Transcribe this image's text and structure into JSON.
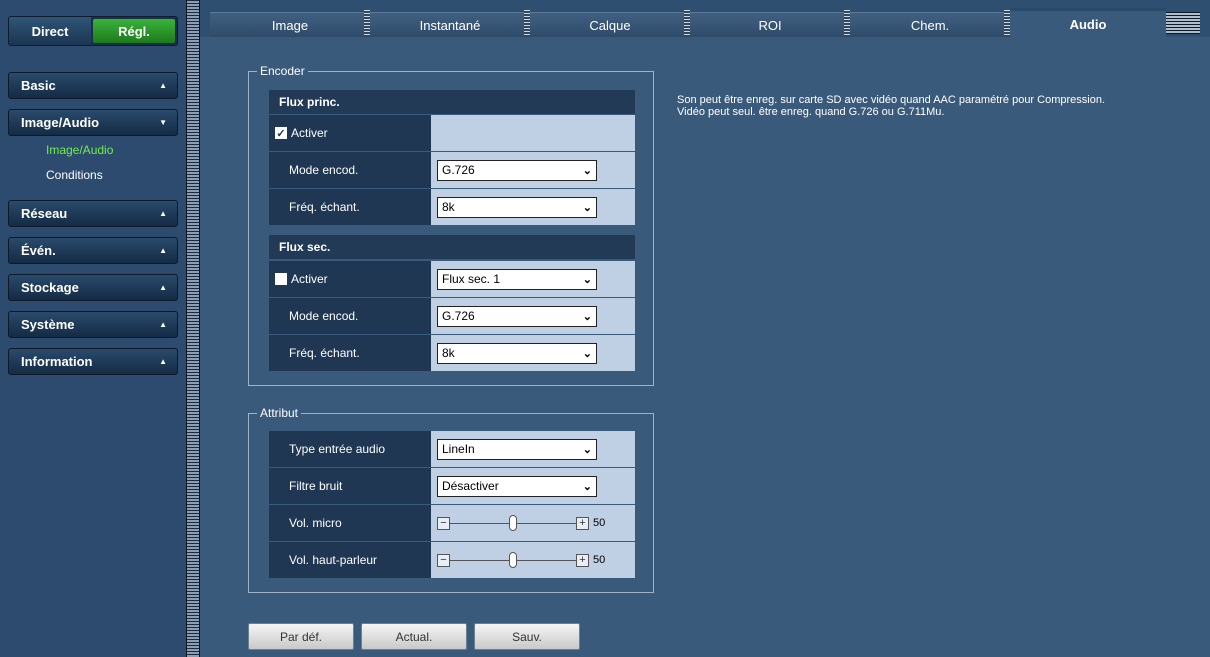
{
  "mode": {
    "direct": "Direct",
    "regl": "Régl."
  },
  "sidebar": {
    "items": [
      {
        "label": "Basic",
        "arrow": "▲"
      },
      {
        "label": "Image/Audio",
        "arrow": "▼",
        "sub": [
          "Image/Audio",
          "Conditions"
        ]
      },
      {
        "label": "Réseau",
        "arrow": "▲"
      },
      {
        "label": "Évén.",
        "arrow": "▲"
      },
      {
        "label": "Stockage",
        "arrow": "▲"
      },
      {
        "label": "Système",
        "arrow": "▲"
      },
      {
        "label": "Information",
        "arrow": "▲"
      }
    ]
  },
  "tabs": [
    "Image",
    "Instantané",
    "Calque",
    "ROI",
    "Chem.",
    "Audio"
  ],
  "encoder": {
    "legend": "Encoder",
    "main": {
      "header": "Flux princ.",
      "enable_label": "Activer",
      "enabled": true,
      "mode_label": "Mode encod.",
      "mode_value": "G.726",
      "freq_label": "Fréq. échant.",
      "freq_value": "8k"
    },
    "sub": {
      "header": "Flux sec.",
      "enable_label": "Activer",
      "enabled": false,
      "stream_value": "Flux sec. 1",
      "mode_label": "Mode encod.",
      "mode_value": "G.726",
      "freq_label": "Fréq. échant.",
      "freq_value": "8k"
    }
  },
  "attribut": {
    "legend": "Attribut",
    "input_type_label": "Type entrée audio",
    "input_type_value": "LineIn",
    "noise_label": "Filtre bruit",
    "noise_value": "Désactiver",
    "mic_label": "Vol. micro",
    "mic_value": "50",
    "speaker_label": "Vol. haut-parleur",
    "speaker_value": "50",
    "minus": "−",
    "plus": "+"
  },
  "note": {
    "line1": "Son peut être enreg. sur carte SD avec vidéo quand AAC paramétré pour Compression.",
    "line2": "Vidéo peut seul. être enreg. quand G.726 ou G.711Mu."
  },
  "buttons": {
    "default": "Par déf.",
    "refresh": "Actual.",
    "save": "Sauv."
  },
  "icons": {
    "check": "✓",
    "chevron": "⌄"
  }
}
